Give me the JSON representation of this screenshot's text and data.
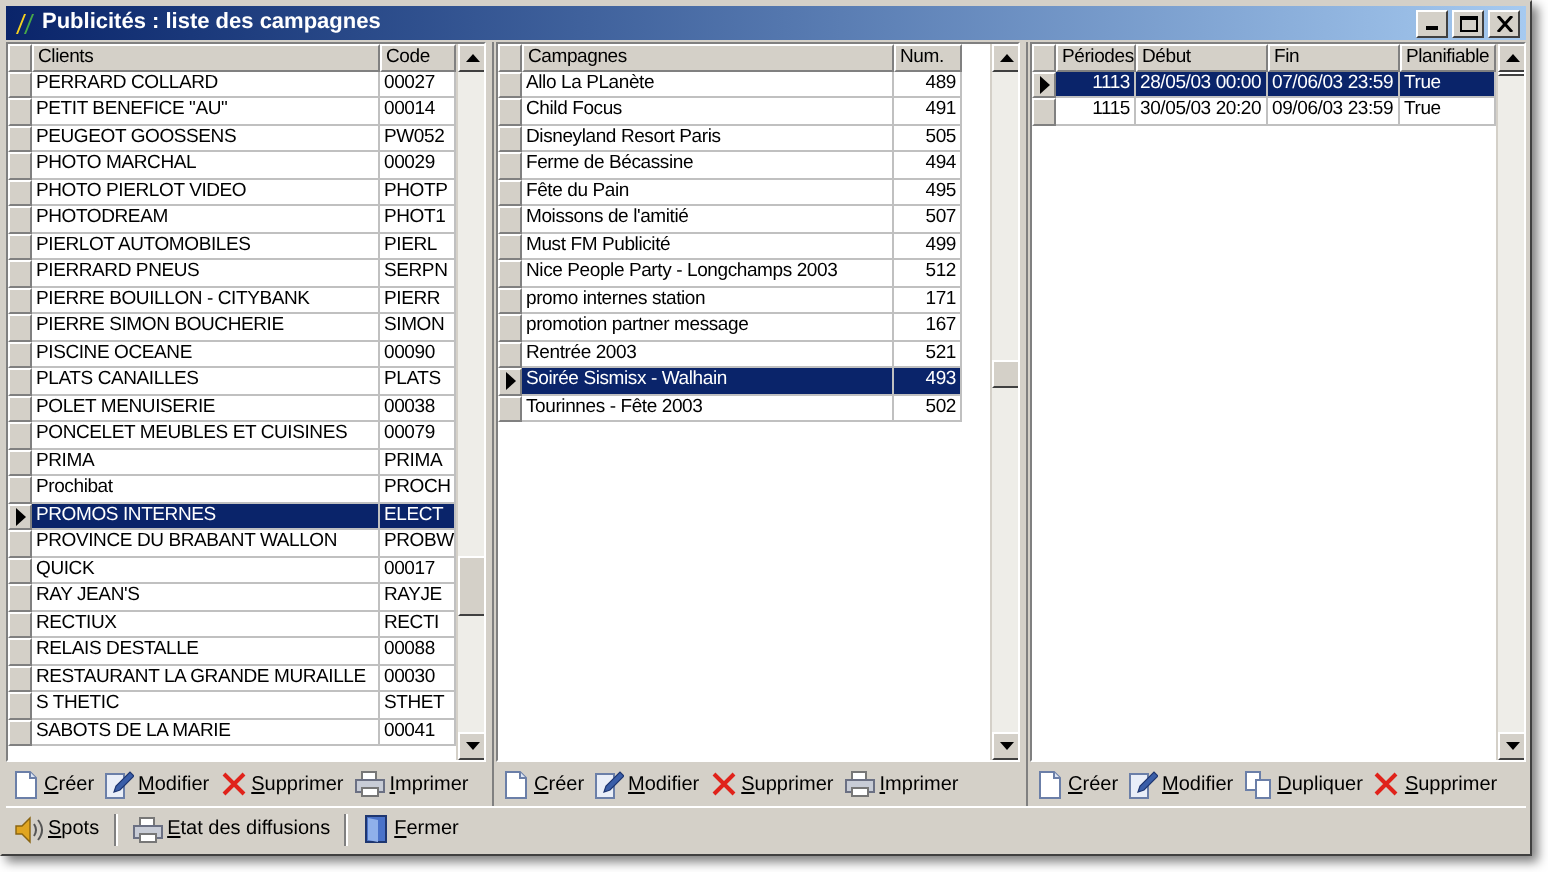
{
  "window": {
    "title": "Publicités : liste des campagnes"
  },
  "clients": {
    "columns": [
      "Clients",
      "Code"
    ],
    "rows": [
      {
        "cells": [
          "PERRARD COLLARD",
          "00027"
        ],
        "selected": false
      },
      {
        "cells": [
          "PETIT BENEFICE \"AU\"",
          "00014"
        ],
        "selected": false
      },
      {
        "cells": [
          "PEUGEOT GOOSSENS",
          "PW052"
        ],
        "selected": false
      },
      {
        "cells": [
          "PHOTO MARCHAL",
          "00029"
        ],
        "selected": false
      },
      {
        "cells": [
          "PHOTO PIERLOT VIDEO",
          "PHOTP"
        ],
        "selected": false
      },
      {
        "cells": [
          "PHOTODREAM",
          "PHOT1"
        ],
        "selected": false
      },
      {
        "cells": [
          "PIERLOT AUTOMOBILES",
          "PIERL"
        ],
        "selected": false
      },
      {
        "cells": [
          "PIERRARD PNEUS",
          "SERPN"
        ],
        "selected": false
      },
      {
        "cells": [
          "PIERRE BOUILLON - CITYBANK",
          "PIERR"
        ],
        "selected": false
      },
      {
        "cells": [
          "PIERRE SIMON BOUCHERIE",
          "SIMON"
        ],
        "selected": false
      },
      {
        "cells": [
          "PISCINE OCEANE",
          "00090"
        ],
        "selected": false
      },
      {
        "cells": [
          "PLATS CANAILLES",
          "PLATS"
        ],
        "selected": false
      },
      {
        "cells": [
          "POLET MENUISERIE",
          "00038"
        ],
        "selected": false
      },
      {
        "cells": [
          "PONCELET MEUBLES ET CUISINES",
          "00079"
        ],
        "selected": false
      },
      {
        "cells": [
          "PRIMA",
          "PRIMA"
        ],
        "selected": false
      },
      {
        "cells": [
          "Prochibat",
          "PROCH"
        ],
        "selected": false
      },
      {
        "cells": [
          "PROMOS INTERNES",
          "ELECT"
        ],
        "selected": true
      },
      {
        "cells": [
          "PROVINCE DU BRABANT WALLON",
          "PROBW"
        ],
        "selected": false
      },
      {
        "cells": [
          "QUICK",
          "00017"
        ],
        "selected": false
      },
      {
        "cells": [
          "RAY JEAN'S",
          "RAYJE"
        ],
        "selected": false
      },
      {
        "cells": [
          "RECTIUX",
          "RECTI"
        ],
        "selected": false
      },
      {
        "cells": [
          "RELAIS DESTALLE",
          "00088"
        ],
        "selected": false
      },
      {
        "cells": [
          "RESTAURANT LA GRANDE MURAILLE",
          "00030"
        ],
        "selected": false
      },
      {
        "cells": [
          "S THETIC",
          "STHET"
        ],
        "selected": false
      },
      {
        "cells": [
          "SABOTS DE LA MARIE",
          "00041"
        ],
        "selected": false
      }
    ],
    "toolbar": [
      {
        "kind": "new",
        "label": "Créer"
      },
      {
        "kind": "edit",
        "label": "Modifier"
      },
      {
        "kind": "delete",
        "label": "Supprimer"
      },
      {
        "kind": "print",
        "label": "Imprimer"
      }
    ]
  },
  "campaigns": {
    "columns": [
      "Campagnes",
      "Num."
    ],
    "rows": [
      {
        "cells": [
          "Allo La PLanète",
          "489"
        ],
        "selected": false
      },
      {
        "cells": [
          "Child Focus",
          "491"
        ],
        "selected": false
      },
      {
        "cells": [
          "Disneyland Resort Paris",
          "505"
        ],
        "selected": false
      },
      {
        "cells": [
          "Ferme de Bécassine",
          "494"
        ],
        "selected": false
      },
      {
        "cells": [
          "Fête du Pain",
          "495"
        ],
        "selected": false
      },
      {
        "cells": [
          "Moissons de l'amitié",
          "507"
        ],
        "selected": false
      },
      {
        "cells": [
          "Must FM Publicité",
          "499"
        ],
        "selected": false
      },
      {
        "cells": [
          "Nice People Party - Longchamps 2003",
          "512"
        ],
        "selected": false
      },
      {
        "cells": [
          "promo internes station",
          "171"
        ],
        "selected": false
      },
      {
        "cells": [
          "promotion partner message",
          "167"
        ],
        "selected": false
      },
      {
        "cells": [
          "Rentrée 2003",
          "521"
        ],
        "selected": false
      },
      {
        "cells": [
          "Soirée Sismisx - Walhain",
          "493"
        ],
        "selected": true
      },
      {
        "cells": [
          "Tourinnes - Fête 2003",
          "502"
        ],
        "selected": false
      }
    ],
    "toolbar": [
      {
        "kind": "new",
        "label": "Créer"
      },
      {
        "kind": "edit",
        "label": "Modifier"
      },
      {
        "kind": "delete",
        "label": "Supprimer"
      },
      {
        "kind": "print",
        "label": "Imprimer"
      }
    ]
  },
  "periods": {
    "columns": [
      "Périodes",
      "Début",
      "Fin",
      "Planifiable"
    ],
    "rows": [
      {
        "cells": [
          "1113",
          "28/05/03 00:00",
          "07/06/03 23:59",
          "True"
        ],
        "selected": true
      },
      {
        "cells": [
          "1115",
          "30/05/03 20:20",
          "09/06/03 23:59",
          "True"
        ],
        "selected": false
      }
    ],
    "toolbar": [
      {
        "kind": "new",
        "label": "Créer"
      },
      {
        "kind": "edit",
        "label": "Modifier"
      },
      {
        "kind": "copy",
        "label": "Dupliquer"
      },
      {
        "kind": "delete",
        "label": "Supprimer"
      }
    ]
  },
  "bottom_bar": [
    {
      "kind": "sound",
      "label": "Spots"
    },
    {
      "kind": "print",
      "label": "Etat des diffusions"
    },
    {
      "kind": "exit",
      "label": "Fermer"
    }
  ]
}
